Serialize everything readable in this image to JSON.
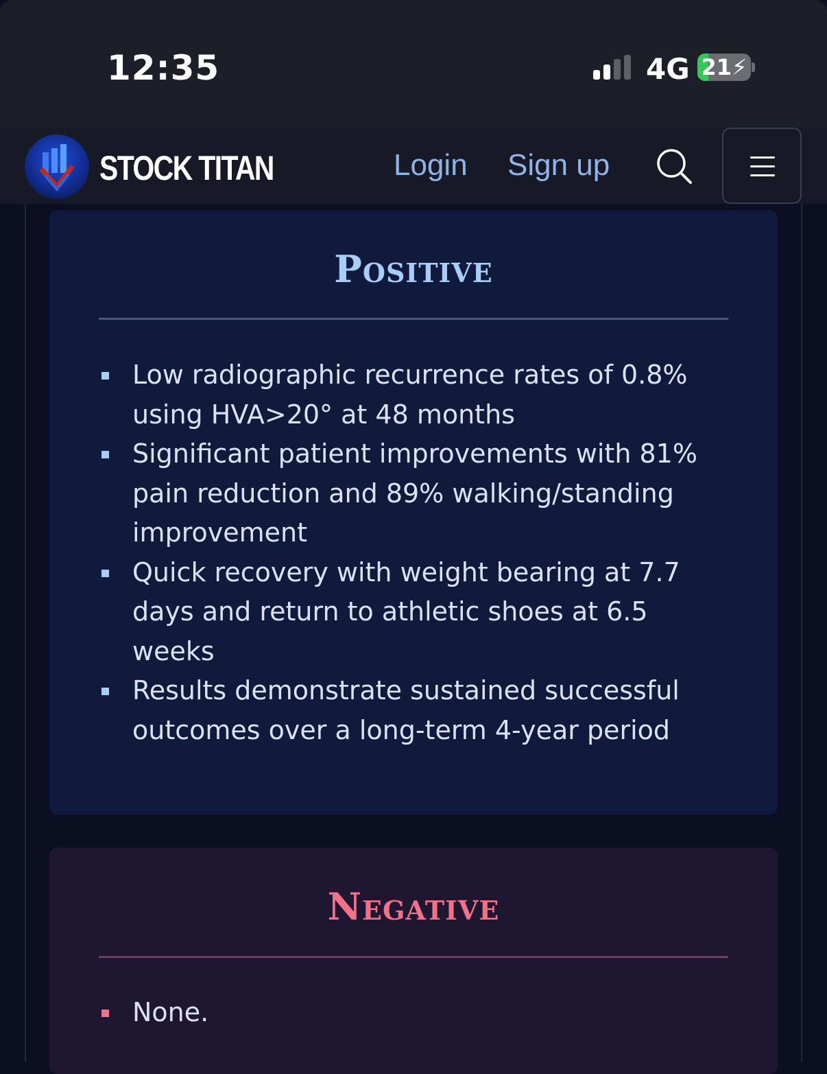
{
  "status_bar": {
    "time": "12:35",
    "network": "4G",
    "battery_level": "21",
    "battery_percent": 21,
    "signal_bars_active": 2,
    "signal_bars_total": 4,
    "charging": true
  },
  "navbar": {
    "brand": "STOCK TITAN",
    "login": "Login",
    "signup": "Sign up",
    "icons": [
      "search-icon",
      "menu-icon"
    ],
    "link_color": "#8fb4e8"
  },
  "positive": {
    "title": "Positive",
    "accent": "#a9cdf5",
    "items": [
      "Low radiographic recurrence rates of 0.8% using HVA>20° at 48 months",
      "Significant patient improvements with 81% pain reduction and 89% walking/standing improvement",
      "Quick recovery with weight bearing at 7.7 days and return to athletic shoes at 6.5 weeks",
      "Results demonstrate sustained successful outcomes over a long-term 4-year period"
    ]
  },
  "negative": {
    "title": "Negative",
    "accent": "#f2718a",
    "items": [
      "None."
    ]
  }
}
